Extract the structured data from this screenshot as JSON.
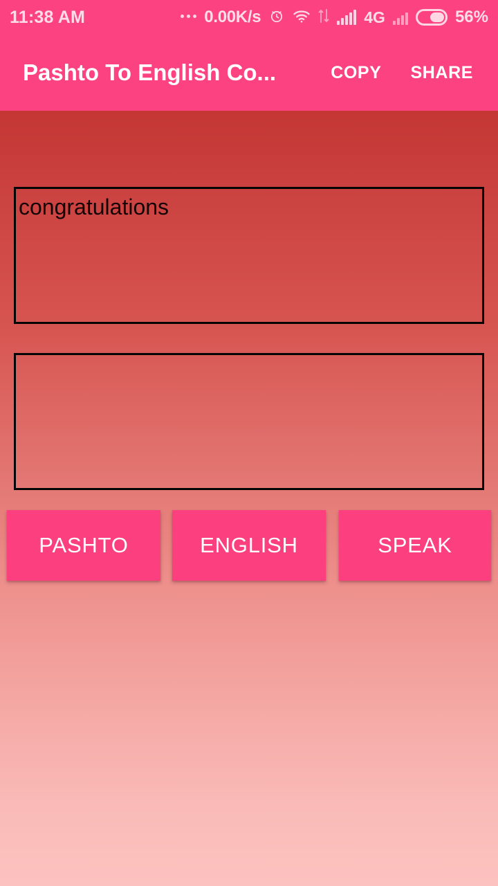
{
  "status_bar": {
    "clock": "11:38 AM",
    "overflow_dots": "…",
    "network_speed": "0.00K/s",
    "alarm_icon": "alarm-clock-icon",
    "wifi_icon": "wifi-icon",
    "data_transfer_icon": "data-transfer-arrows-icon",
    "signal_icon_1": "signal-bars-icon",
    "network_type": "4G",
    "signal_icon_2": "signal-bars-icon",
    "battery_icon": "battery-icon",
    "battery_percent": "56%",
    "battery_level": 56
  },
  "app_bar": {
    "title": "Pashto To English Co...",
    "copy_label": "COPY",
    "share_label": "SHARE"
  },
  "main": {
    "input_box": {
      "value": "congratulations",
      "placeholder": ""
    },
    "output_box": {
      "value": "",
      "placeholder": ""
    }
  },
  "buttons": {
    "pashto": "PASHTO",
    "english": "ENGLISH",
    "speak": "SPEAK"
  },
  "colors": {
    "accent_pink": "#FC4280",
    "button_pink": "#FB3F7F",
    "gradient_top": "#C33634",
    "gradient_bottom": "#FCC2BF",
    "box_border": "#050505",
    "text_on_accent": "#FFFFFF"
  }
}
